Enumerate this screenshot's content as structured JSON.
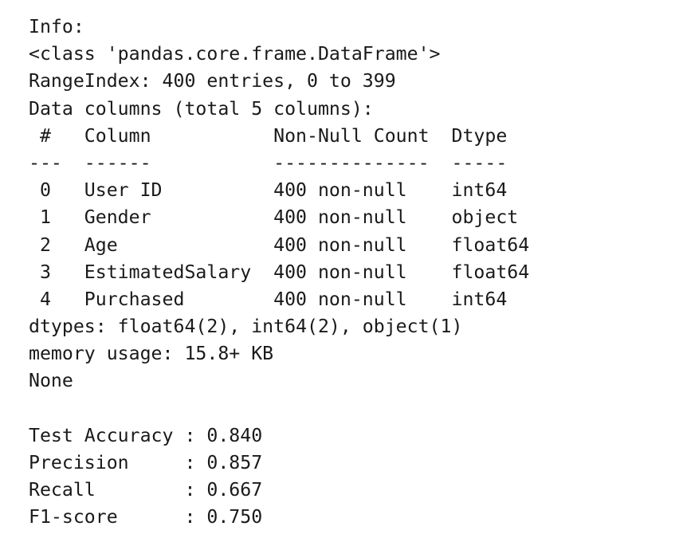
{
  "output": {
    "info_header": "Info:",
    "class_line": "<class 'pandas.core.frame.DataFrame'>",
    "range_index": "RangeIndex: 400 entries, 0 to 399",
    "data_columns": "Data columns (total 5 columns):",
    "table_header": " #   Column           Non-Null Count  Dtype  ",
    "table_divider": "---  ------           --------------  -----  ",
    "rows": [
      " 0   User ID          400 non-null    int64  ",
      " 1   Gender           400 non-null    object ",
      " 2   Age              400 non-null    float64",
      " 3   EstimatedSalary  400 non-null    float64",
      " 4   Purchased        400 non-null    int64  "
    ],
    "dtypes": "dtypes: float64(2), int64(2), object(1)",
    "memory": "memory usage: 15.8+ KB",
    "none": "None",
    "metrics": [
      "Test Accuracy : 0.840",
      "Precision     : 0.857",
      "Recall        : 0.667",
      "F1-score      : 0.750"
    ]
  }
}
